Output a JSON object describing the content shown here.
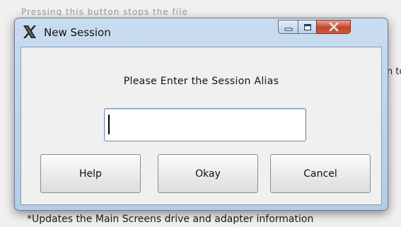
{
  "background": {
    "top_text": "Pressing this button stops the file",
    "right_text": "n to",
    "bottom_text": "*Updates the Main Screens drive and adapter information"
  },
  "dialog": {
    "title": "New Session",
    "prompt": "Please Enter the Session Alias",
    "alias_value": "",
    "buttons": {
      "help": "Help",
      "okay": "Okay",
      "cancel": "Cancel"
    }
  },
  "icons": {
    "app": "x-app-icon",
    "minimize": "minimize-icon",
    "maximize": "maximize-icon",
    "close": "close-icon"
  }
}
